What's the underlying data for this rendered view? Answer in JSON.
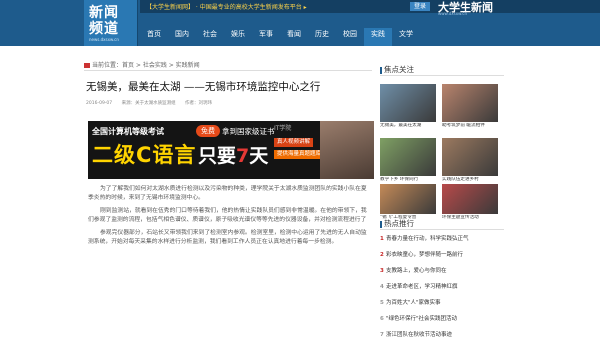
{
  "header": {
    "logo_line1": "新闻",
    "logo_line2": "频道",
    "logo_url": "news.dxsxw.cn",
    "ticker": "【大学生新闻网】 · 中国最专业的高校大学生新闻发布平台 ▸",
    "top_button": "登录",
    "brand": "大学生新闻",
    "brand_url": "www.dxsxw.cn",
    "nav": [
      "首页",
      "国内",
      "社会",
      "娱乐",
      "军事",
      "看闻",
      "历史",
      "校园",
      "实践",
      "文学"
    ]
  },
  "breadcrumb": "当前位置：首页 > 社会实践 > 实践新闻",
  "article": {
    "title": "无锡美，最美在太湖 ——无锡市环境监控中心之行",
    "date": "2016-09-07",
    "source": "来源：关于太湖水质监测组",
    "author": "作者：刘玥玮",
    "ad": {
      "line1": "全国计算机等级考试",
      "line2": "二级C语言",
      "badge": "免费",
      "line3": "拿到国家级证书",
      "line4_a": "只要",
      "line4_num": "7",
      "line4_b": "天",
      "logo": "IT学院",
      "pill1": "真人视频讲解",
      "pill2": "提供海量真题题库"
    },
    "paragraphs": [
      "为了了解我们如何对太湖水质进行检测以及污染物的种类，理学院关于太湖水质监测团队的实践小队在夏季炎热的时候，来到了无锡市环境监测中心。",
      "刚到监测站，就看到在伍秀的门口等待着我们，他的热情让实践队员们感到非常温暖。在他的带领下，我们参观了监测的流程，包括气相色谱仪、质谱仪，原子吸收光谱仪等等先进的仪器设备，并对检测流程进行了详细的介绍，让我们对环境监测工作有了初步的了解。",
      "参观完仪器部分，石站长又带领我们来到了检测室内参观。检测室里，检测中心运用了先进的无人自动监测系统，开始对每天采集的水样进行分析监测，我们看到工作人员正在认真地进行着每一步检测。"
    ]
  },
  "sidebar": {
    "focus_title": "焦点关注",
    "focus": [
      {
        "caption": "无锡美，最美在太湖",
        "color": "#6f8fa8"
      },
      {
        "caption": "助考筑梦前 暖流相伴",
        "color": "#b9846d"
      },
      {
        "caption": "教学下乡 环保同行",
        "color": "#7fa064"
      },
      {
        "caption": "实践队伍走进乡村",
        "color": "#9c7a60"
      },
      {
        "caption": "\"锡飞\"工程夏令营",
        "color": "#c48a58"
      },
      {
        "caption": "环保主题宣传活动",
        "color": "#b84a4a"
      }
    ],
    "hot_title": "热点推行",
    "hot": [
      "青春力量在行动，科学实践弘正气",
      "彩衣映童心，梦想伴随一路前行",
      "支教路上，爱心与你同在",
      "走进革命老区，学习精神红旗",
      "为百姓大\"人\"家做实事",
      "\"绿色环保行\"社会实践团活动",
      "浙江团队在秋收节活动事迹"
    ]
  }
}
